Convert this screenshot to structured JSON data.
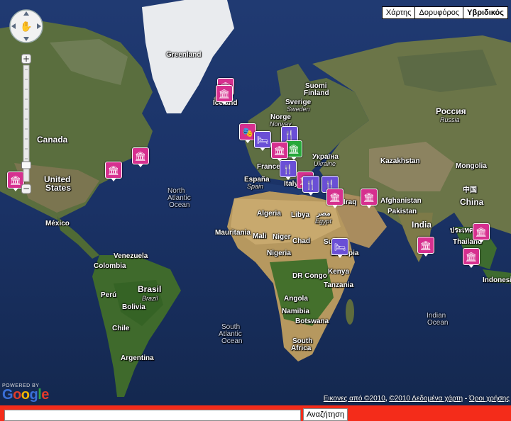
{
  "map_type": {
    "buttons": [
      {
        "label": "Χάρτης",
        "active": false
      },
      {
        "label": "Δορυφόρος",
        "active": false
      },
      {
        "label": "Υβριδικός",
        "active": true
      }
    ]
  },
  "labels": {
    "greenland": "Greenland",
    "iceland": "Iceland",
    "suomi": "Suomi",
    "finland": "Finland",
    "sverige": "Sverige",
    "sweden": "Sweden",
    "norge": "Norge",
    "norway": "Norway",
    "russia": "Россия",
    "russia_sub": "Russia",
    "canada": "Canada",
    "ukraina": "Україна",
    "ukraine": "Ukraine",
    "france": "France",
    "kazakhstan": "Kazakhstan",
    "mongolia": "Mongolia",
    "united_states_1": "United",
    "united_states_2": "States",
    "espana": "España",
    "spain": "Spain",
    "italy": "Italy",
    "china_local": "中国",
    "china": "China",
    "north_atlantic_1": "North",
    "north_atlantic_2": "Atlantic",
    "north_atlantic_3": "Ocean",
    "algeria": "Algeria",
    "libya": "Libya",
    "misr": "مصر",
    "egypt": "Egypt",
    "iraq": "Iraq",
    "afghanistan": "Afghanistan",
    "pakistan": "Pakistan",
    "mexico": "México",
    "mauritania": "Mauritania",
    "mali": "Mali",
    "niger": "Niger",
    "chad": "Chad",
    "sudan": "Sudan",
    "india": "India",
    "thailand_local": "ประเทศ",
    "thailand": "Thailand",
    "venezuela": "Venezuela",
    "colombia": "Colombia",
    "nigeria": "Nigeria",
    "ethiopia": "Ethiopia",
    "dr_congo": "DR Congo",
    "kenya": "Kenya",
    "tanzania": "Tanzania",
    "brasil": "Brasil",
    "brazil": "Brazil",
    "peru": "Perú",
    "bolivia": "Bolivia",
    "angola": "Angola",
    "namibia": "Namibia",
    "botswana": "Botswana",
    "indian_ocean_1": "Indian",
    "indian_ocean_2": "Ocean",
    "indonesia": "Indonesi",
    "chile": "Chile",
    "south_atlantic_1": "South",
    "south_atlantic_2": "Atlantic",
    "south_atlantic_3": "Ocean",
    "south_africa_1": "South",
    "south_africa_2": "Africa",
    "argentina": "Argentina"
  },
  "markers": {
    "museum_icon": "museum-icon",
    "restaurant_icon": "fork-knife-icon",
    "theater_icon": "theater-masks-icon",
    "hotel_icon": "bed-icon",
    "pink": "#d6308f",
    "purple": "#6a4fd6",
    "green": "#27a83a"
  },
  "branding": {
    "powered_by": "POWERED BY",
    "logo": "Google"
  },
  "attribution": {
    "imagery": "Εικονες από ©2010",
    "data": "©2010 Δεδομένα χάρτη",
    "separator": " - ",
    "terms": "Όροι χρήσης"
  },
  "search": {
    "value": "",
    "button_label": "Αναζήτηση",
    "bar_color": "#f42c1a"
  }
}
